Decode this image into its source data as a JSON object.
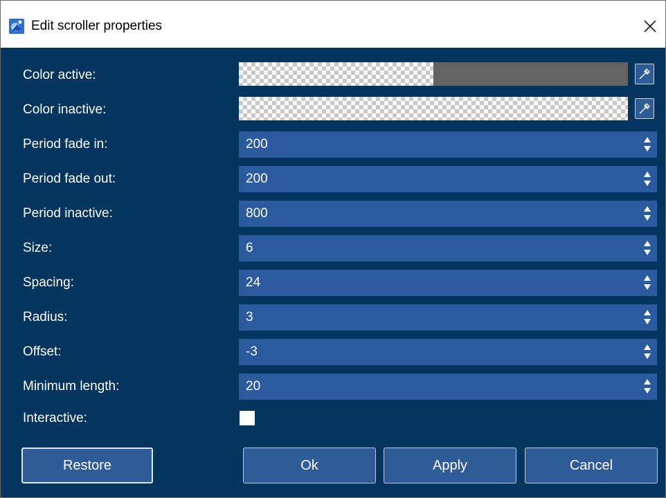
{
  "window": {
    "title": "Edit scroller properties"
  },
  "form": {
    "color_active": {
      "label": "Color active:",
      "opacity": 0.5
    },
    "color_inactive": {
      "label": "Color inactive:",
      "opacity": 0
    },
    "fields": [
      {
        "label": "Period fade in:",
        "value": "200"
      },
      {
        "label": "Period fade out:",
        "value": "200"
      },
      {
        "label": "Period inactive:",
        "value": "800"
      },
      {
        "label": "Size:",
        "value": "6"
      },
      {
        "label": "Spacing:",
        "value": "24"
      },
      {
        "label": "Radius:",
        "value": "3"
      },
      {
        "label": "Offset:",
        "value": "-3"
      },
      {
        "label": "Minimum length:",
        "value": "20"
      }
    ],
    "interactive": {
      "label": "Interactive:",
      "checked": false
    }
  },
  "buttons": {
    "restore": "Restore",
    "ok": "Ok",
    "apply": "Apply",
    "cancel": "Cancel"
  },
  "icons": {
    "app": "app-icon",
    "close": "close-icon",
    "eyedropper": "eyedropper-icon",
    "spin_up": "triangle-up-icon",
    "spin_down": "triangle-down-icon"
  },
  "colors": {
    "dialog_bg": "#04355f",
    "field_bg": "#2b5b9f",
    "button_bg": "#2f5b98",
    "color_active_fill": "#636363"
  }
}
